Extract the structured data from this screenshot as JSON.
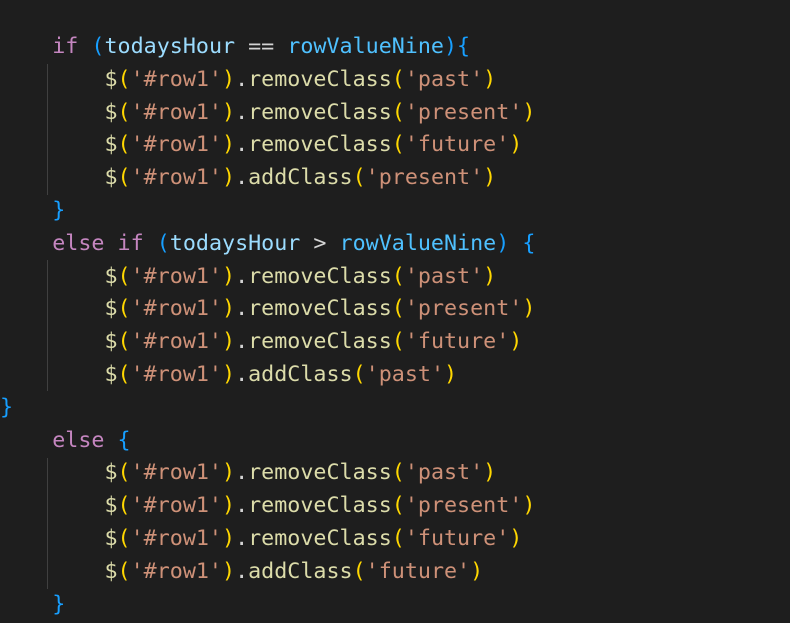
{
  "editor": {
    "lines": [
      [
        {
          "t": "    ",
          "c": "ws"
        },
        {
          "t": "if",
          "c": "kw"
        },
        {
          "t": " ",
          "c": "ws"
        },
        {
          "t": "(",
          "c": "par-c"
        },
        {
          "t": "todaysHour",
          "c": "var"
        },
        {
          "t": " == ",
          "c": "op"
        },
        {
          "t": "rowValueNine",
          "c": "const"
        },
        {
          "t": ")",
          "c": "par-c"
        },
        {
          "t": "{",
          "c": "par-c"
        }
      ],
      [
        {
          "t": "        ",
          "c": "ws"
        },
        {
          "t": "$",
          "c": "fn"
        },
        {
          "t": "(",
          "c": "par-a"
        },
        {
          "t": "'#row1'",
          "c": "str"
        },
        {
          "t": ")",
          "c": "par-a"
        },
        {
          "t": ".",
          "c": "op"
        },
        {
          "t": "removeClass",
          "c": "fn"
        },
        {
          "t": "(",
          "c": "par-a"
        },
        {
          "t": "'past'",
          "c": "str"
        },
        {
          "t": ")",
          "c": "par-a"
        }
      ],
      [
        {
          "t": "        ",
          "c": "ws"
        },
        {
          "t": "$",
          "c": "fn"
        },
        {
          "t": "(",
          "c": "par-a"
        },
        {
          "t": "'#row1'",
          "c": "str"
        },
        {
          "t": ")",
          "c": "par-a"
        },
        {
          "t": ".",
          "c": "op"
        },
        {
          "t": "removeClass",
          "c": "fn"
        },
        {
          "t": "(",
          "c": "par-a"
        },
        {
          "t": "'present'",
          "c": "str"
        },
        {
          "t": ")",
          "c": "par-a"
        }
      ],
      [
        {
          "t": "        ",
          "c": "ws"
        },
        {
          "t": "$",
          "c": "fn"
        },
        {
          "t": "(",
          "c": "par-a"
        },
        {
          "t": "'#row1'",
          "c": "str"
        },
        {
          "t": ")",
          "c": "par-a"
        },
        {
          "t": ".",
          "c": "op"
        },
        {
          "t": "removeClass",
          "c": "fn"
        },
        {
          "t": "(",
          "c": "par-a"
        },
        {
          "t": "'future'",
          "c": "str"
        },
        {
          "t": ")",
          "c": "par-a"
        }
      ],
      [
        {
          "t": "        ",
          "c": "ws"
        },
        {
          "t": "$",
          "c": "fn"
        },
        {
          "t": "(",
          "c": "par-a"
        },
        {
          "t": "'#row1'",
          "c": "str"
        },
        {
          "t": ")",
          "c": "par-a"
        },
        {
          "t": ".",
          "c": "op"
        },
        {
          "t": "addClass",
          "c": "fn"
        },
        {
          "t": "(",
          "c": "par-a"
        },
        {
          "t": "'present'",
          "c": "str"
        },
        {
          "t": ")",
          "c": "par-a"
        }
      ],
      [
        {
          "t": "    ",
          "c": "ws"
        },
        {
          "t": "}",
          "c": "par-c"
        }
      ],
      [
        {
          "t": "    ",
          "c": "ws"
        },
        {
          "t": "else",
          "c": "kw"
        },
        {
          "t": " ",
          "c": "ws"
        },
        {
          "t": "if",
          "c": "kw"
        },
        {
          "t": " ",
          "c": "ws"
        },
        {
          "t": "(",
          "c": "par-c"
        },
        {
          "t": "todaysHour",
          "c": "var"
        },
        {
          "t": " > ",
          "c": "op"
        },
        {
          "t": "rowValueNine",
          "c": "const"
        },
        {
          "t": ")",
          "c": "par-c"
        },
        {
          "t": " ",
          "c": "ws"
        },
        {
          "t": "{",
          "c": "par-c"
        }
      ],
      [
        {
          "t": "        ",
          "c": "ws"
        },
        {
          "t": "$",
          "c": "fn"
        },
        {
          "t": "(",
          "c": "par-a"
        },
        {
          "t": "'#row1'",
          "c": "str"
        },
        {
          "t": ")",
          "c": "par-a"
        },
        {
          "t": ".",
          "c": "op"
        },
        {
          "t": "removeClass",
          "c": "fn"
        },
        {
          "t": "(",
          "c": "par-a"
        },
        {
          "t": "'past'",
          "c": "str"
        },
        {
          "t": ")",
          "c": "par-a"
        }
      ],
      [
        {
          "t": "        ",
          "c": "ws"
        },
        {
          "t": "$",
          "c": "fn"
        },
        {
          "t": "(",
          "c": "par-a"
        },
        {
          "t": "'#row1'",
          "c": "str"
        },
        {
          "t": ")",
          "c": "par-a"
        },
        {
          "t": ".",
          "c": "op"
        },
        {
          "t": "removeClass",
          "c": "fn"
        },
        {
          "t": "(",
          "c": "par-a"
        },
        {
          "t": "'present'",
          "c": "str"
        },
        {
          "t": ")",
          "c": "par-a"
        }
      ],
      [
        {
          "t": "        ",
          "c": "ws"
        },
        {
          "t": "$",
          "c": "fn"
        },
        {
          "t": "(",
          "c": "par-a"
        },
        {
          "t": "'#row1'",
          "c": "str"
        },
        {
          "t": ")",
          "c": "par-a"
        },
        {
          "t": ".",
          "c": "op"
        },
        {
          "t": "removeClass",
          "c": "fn"
        },
        {
          "t": "(",
          "c": "par-a"
        },
        {
          "t": "'future'",
          "c": "str"
        },
        {
          "t": ")",
          "c": "par-a"
        }
      ],
      [
        {
          "t": "        ",
          "c": "ws"
        },
        {
          "t": "$",
          "c": "fn"
        },
        {
          "t": "(",
          "c": "par-a"
        },
        {
          "t": "'#row1'",
          "c": "str"
        },
        {
          "t": ")",
          "c": "par-a"
        },
        {
          "t": ".",
          "c": "op"
        },
        {
          "t": "addClass",
          "c": "fn"
        },
        {
          "t": "(",
          "c": "par-a"
        },
        {
          "t": "'past'",
          "c": "str"
        },
        {
          "t": ")",
          "c": "par-a"
        }
      ],
      [
        {
          "t": "}",
          "c": "par-c"
        }
      ],
      [
        {
          "t": "    ",
          "c": "ws"
        },
        {
          "t": "else",
          "c": "kw"
        },
        {
          "t": " ",
          "c": "ws"
        },
        {
          "t": "{",
          "c": "par-c"
        }
      ],
      [
        {
          "t": "        ",
          "c": "ws"
        },
        {
          "t": "$",
          "c": "fn"
        },
        {
          "t": "(",
          "c": "par-a"
        },
        {
          "t": "'#row1'",
          "c": "str"
        },
        {
          "t": ")",
          "c": "par-a"
        },
        {
          "t": ".",
          "c": "op"
        },
        {
          "t": "removeClass",
          "c": "fn"
        },
        {
          "t": "(",
          "c": "par-a"
        },
        {
          "t": "'past'",
          "c": "str"
        },
        {
          "t": ")",
          "c": "par-a"
        }
      ],
      [
        {
          "t": "        ",
          "c": "ws"
        },
        {
          "t": "$",
          "c": "fn"
        },
        {
          "t": "(",
          "c": "par-a"
        },
        {
          "t": "'#row1'",
          "c": "str"
        },
        {
          "t": ")",
          "c": "par-a"
        },
        {
          "t": ".",
          "c": "op"
        },
        {
          "t": "removeClass",
          "c": "fn"
        },
        {
          "t": "(",
          "c": "par-a"
        },
        {
          "t": "'present'",
          "c": "str"
        },
        {
          "t": ")",
          "c": "par-a"
        }
      ],
      [
        {
          "t": "        ",
          "c": "ws"
        },
        {
          "t": "$",
          "c": "fn"
        },
        {
          "t": "(",
          "c": "par-a"
        },
        {
          "t": "'#row1'",
          "c": "str"
        },
        {
          "t": ")",
          "c": "par-a"
        },
        {
          "t": ".",
          "c": "op"
        },
        {
          "t": "removeClass",
          "c": "fn"
        },
        {
          "t": "(",
          "c": "par-a"
        },
        {
          "t": "'future'",
          "c": "str"
        },
        {
          "t": ")",
          "c": "par-a"
        }
      ],
      [
        {
          "t": "        ",
          "c": "ws"
        },
        {
          "t": "$",
          "c": "fn"
        },
        {
          "t": "(",
          "c": "par-a"
        },
        {
          "t": "'#row1'",
          "c": "str"
        },
        {
          "t": ")",
          "c": "par-a"
        },
        {
          "t": ".",
          "c": "op"
        },
        {
          "t": "addClass",
          "c": "fn"
        },
        {
          "t": "(",
          "c": "par-a"
        },
        {
          "t": "'future'",
          "c": "str"
        },
        {
          "t": ")",
          "c": "par-a"
        }
      ],
      [
        {
          "t": "    ",
          "c": "ws"
        },
        {
          "t": "}",
          "c": "par-c"
        }
      ]
    ]
  },
  "colors": {
    "background": "#1e1e1e",
    "keyword": "#c586c0",
    "variable": "#9cdcfe",
    "constant": "#4fc1ff",
    "function": "#dcdcaa",
    "string": "#ce9178",
    "bracket_gold": "#ffd700",
    "bracket_blue": "#179fff",
    "indent_guide": "#404040"
  }
}
